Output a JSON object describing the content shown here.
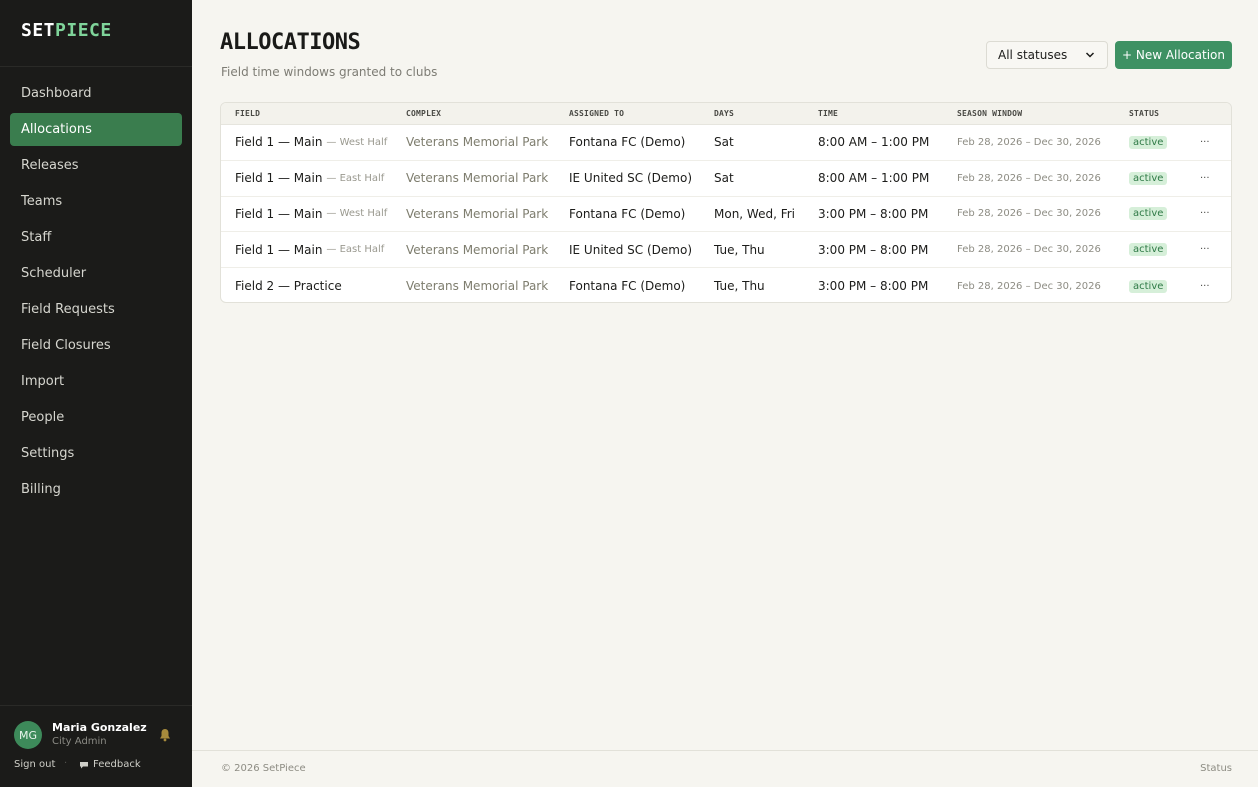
{
  "brand": {
    "part1": "SET",
    "part2": "PIECE"
  },
  "sidebar": {
    "items": [
      {
        "label": "Dashboard"
      },
      {
        "label": "Allocations",
        "active": true
      },
      {
        "label": "Releases"
      },
      {
        "label": "Teams"
      },
      {
        "label": "Staff"
      },
      {
        "label": "Scheduler"
      },
      {
        "label": "Field Requests"
      },
      {
        "label": "Field Closures"
      },
      {
        "label": "Import"
      },
      {
        "label": "People"
      },
      {
        "label": "Settings"
      },
      {
        "label": "Billing"
      }
    ]
  },
  "user": {
    "initials": "MG",
    "name": "Maria Gonzalez",
    "role": "City Admin",
    "signout_label": "Sign out",
    "feedback_label": "Feedback"
  },
  "page": {
    "title": "ALLOCATIONS",
    "subtitle": "Field time windows granted to clubs"
  },
  "toolbar": {
    "status_filter_value": "All statuses",
    "new_button_label": "+ New Allocation"
  },
  "table": {
    "headers": {
      "field": "FIELD",
      "complex": "COMPLEX",
      "assigned": "ASSIGNED TO",
      "days": "DAYS",
      "time": "TIME",
      "season": "SEASON WINDOW",
      "status": "STATUS"
    },
    "rows": [
      {
        "field": "Field 1 — Main",
        "sub": "— West Half",
        "complex": "Veterans Memorial Park",
        "assigned": "Fontana FC (Demo)",
        "days": "Sat",
        "time": "8:00 AM – 1:00 PM",
        "season": "Feb 28, 2026 – Dec 30, 2026",
        "status": "active",
        "more": "···"
      },
      {
        "field": "Field 1 — Main",
        "sub": "— East Half",
        "complex": "Veterans Memorial Park",
        "assigned": "IE United SC (Demo)",
        "days": "Sat",
        "time": "8:00 AM – 1:00 PM",
        "season": "Feb 28, 2026 – Dec 30, 2026",
        "status": "active",
        "more": "···"
      },
      {
        "field": "Field 1 — Main",
        "sub": "— West Half",
        "complex": "Veterans Memorial Park",
        "assigned": "Fontana FC (Demo)",
        "days": "Mon, Wed, Fri",
        "time": "3:00 PM – 8:00 PM",
        "season": "Feb 28, 2026 – Dec 30, 2026",
        "status": "active",
        "more": "···"
      },
      {
        "field": "Field 1 — Main",
        "sub": "— East Half",
        "complex": "Veterans Memorial Park",
        "assigned": "IE United SC (Demo)",
        "days": "Tue, Thu",
        "time": "3:00 PM – 8:00 PM",
        "season": "Feb 28, 2026 – Dec 30, 2026",
        "status": "active",
        "more": "···"
      },
      {
        "field": "Field 2 — Practice",
        "sub": "",
        "complex": "Veterans Memorial Park",
        "assigned": "Fontana FC (Demo)",
        "days": "Tue, Thu",
        "time": "3:00 PM – 8:00 PM",
        "season": "Feb 28, 2026 – Dec 30, 2026",
        "status": "active",
        "more": "···"
      }
    ]
  },
  "footer": {
    "copyright": "© 2026 SetPiece",
    "status_link": "Status"
  },
  "colors": {
    "sidebar_bg": "#1b1b19",
    "accent": "#3e9163",
    "active_nav": "#3a7d4e",
    "badge_bg": "#d6efd9",
    "badge_text": "#2f7a46",
    "logo_accent": "#7fd49a"
  },
  "icons": {
    "bell": "bell-icon",
    "feedback": "chat-bubble-icon",
    "dropdown": "chevron-down-icon"
  }
}
